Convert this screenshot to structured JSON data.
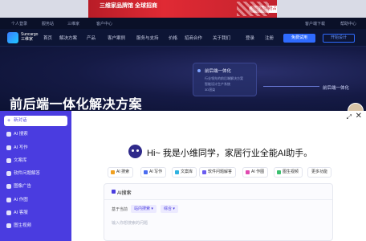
{
  "promo": {
    "headline": "三维家品牌馆 全球招商",
    "subline": "",
    "cta": "立即入驻 抢占流量先机"
  },
  "utility": {
    "items": [
      "个人登录",
      "服务站",
      "三维家",
      "客户中心"
    ],
    "right_items": [
      "客户端下载",
      "帮助中心"
    ]
  },
  "nav": {
    "brand": "Suncargo",
    "brand_sub": "三维家",
    "items": [
      "首页",
      "解决方案",
      "产品",
      "客户案例",
      "服务与支持",
      "价格",
      "招商合作",
      "关于我们"
    ],
    "login": "登录",
    "register": "注册",
    "trial_button": "免费试用",
    "design_button": "开始设计"
  },
  "hero": {
    "title": "前后端一体化解决方案",
    "card_title": "前后端一体化",
    "card_lines": [
      "行业领先的前后端解决方案",
      "智能设计生产系统",
      "3D渲染"
    ],
    "tag": "前后端一体化"
  },
  "sidebar": {
    "new_chat": "新对话",
    "items": [
      "AI 搜索",
      "AI 写作",
      "文案库",
      "软件问题解答",
      "图像广告",
      "AI 作图",
      "AI 客服",
      "图生视频"
    ]
  },
  "assistant": {
    "greeting": "Hi~ 我是小维同学，家居行业全能AI助手。",
    "chips": [
      {
        "label": "AI 搜索",
        "color": "#f0a020"
      },
      {
        "label": "AI 写作",
        "color": "#4a6cf0"
      },
      {
        "label": "文案库",
        "color": "#2fb2e0"
      },
      {
        "label": "软件问题解答",
        "color": "#6a5cf0"
      },
      {
        "label": "AI 作图",
        "color": "#e04ab0"
      },
      {
        "label": "图生视频",
        "color": "#3cc070"
      },
      {
        "label": "更多功能",
        "color": "#ffffff"
      }
    ],
    "search_panel": {
      "title": "AI搜索",
      "based_on": "基于当前",
      "source": "站内搜索",
      "scope": "综合",
      "placeholder": "输入你想搜索的问题"
    }
  }
}
